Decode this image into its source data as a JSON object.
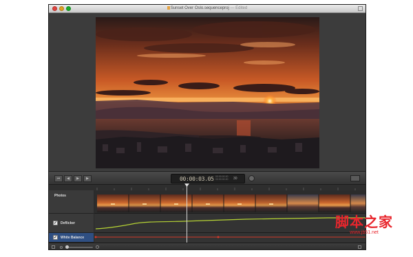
{
  "window": {
    "title": "Sunset Over Oslo.sequenceproj",
    "title_status": "— Edited"
  },
  "transport": {
    "buttons": [
      "to-start",
      "step-back",
      "play",
      "step-forward"
    ],
    "timecode": "00:00:03.05",
    "timecode_sub_top": "00:00:00.00",
    "timecode_sub_bottom": "00:00:00.00",
    "fps": "30"
  },
  "tracks": {
    "photos": {
      "label": "Photos"
    },
    "deflicker": {
      "label": "Deflicker",
      "checked": true
    },
    "white_balance": {
      "label": "White Balance",
      "checked": true,
      "selected": true
    }
  },
  "playhead": {
    "time": "00:00:03.05"
  },
  "deflicker_curve": {
    "color": "#b7d434"
  },
  "white_balance_curve": {
    "color": "#d23a2a"
  },
  "watermark": {
    "text_cn": "脚本之家",
    "url": "www.jb51.net"
  },
  "colors": {
    "accent_selection": "#2f4f82",
    "sky_orange": "#e0772f"
  }
}
